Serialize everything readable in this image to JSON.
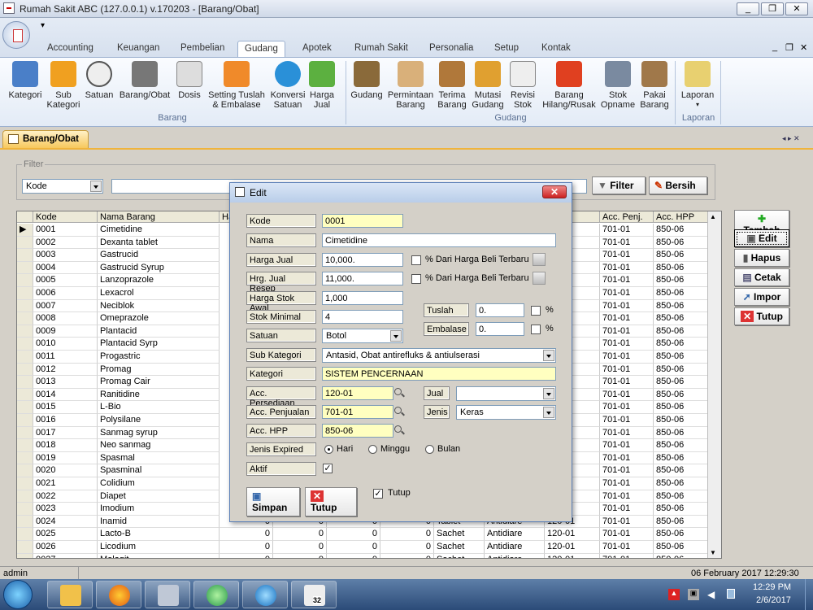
{
  "window": {
    "title": "Rumah Sakit ABC (127.0.0.1) v.170203 - [Barang/Obat]",
    "min": "_",
    "max": "❐",
    "close": "✕",
    "mdi_min": "_",
    "mdi_max": "❐",
    "mdi_close": "✕"
  },
  "ribbon": {
    "tabs": [
      "Accounting",
      "Keuangan",
      "Pembelian",
      "Gudang",
      "Apotek",
      "Rumah Sakit",
      "Personalia",
      "Setup",
      "Kontak"
    ],
    "active_tab": "Gudang",
    "barang_buttons": [
      "Kategori",
      "Sub Kategori",
      "Satuan",
      "Barang/Obat",
      "Dosis",
      "Setting Tuslah & Embalase",
      "Konversi Satuan",
      "Harga Jual"
    ],
    "gudang_buttons": [
      "Gudang",
      "Permintaan Barang",
      "Terima Barang",
      "Mutasi Gudang",
      "Revisi Stok",
      "Barang Hilang/Rusak",
      "Stok Opname",
      "Pakai Barang"
    ],
    "laporan_button": "Laporan",
    "groups": {
      "barang": "Barang",
      "gudang": "Gudang",
      "laporan": "Laporan"
    }
  },
  "doc_tab": "Barang/Obat",
  "filter": {
    "legend": "Filter",
    "field_value": "Kode",
    "filter_button": "Filter",
    "clear_button": "Bersih"
  },
  "grid": {
    "headers": [
      "Kode",
      "Nama Barang",
      "Ha",
      "Pers.",
      "Acc. Penj.",
      "Acc. HPP"
    ],
    "rows": [
      [
        "0001",
        "Cimetidine"
      ],
      [
        "0002",
        "Dexanta tablet"
      ],
      [
        "0003",
        "Gastrucid"
      ],
      [
        "0004",
        "Gastrucid Syrup"
      ],
      [
        "0005",
        "Lanzoprazole"
      ],
      [
        "0006",
        "Lexacrol"
      ],
      [
        "0007",
        "Neciblok"
      ],
      [
        "0008",
        "Omeprazole"
      ],
      [
        "0009",
        "Plantacid"
      ],
      [
        "0010",
        "Plantacid Syrp"
      ],
      [
        "0011",
        "Progastric"
      ],
      [
        "0012",
        "Promag"
      ],
      [
        "0013",
        "Promag Cair"
      ],
      [
        "0014",
        "Ranitidine"
      ],
      [
        "0015",
        "L-Bio"
      ],
      [
        "0016",
        "Polysilane"
      ],
      [
        "0017",
        "Sanmag syrup"
      ],
      [
        "0018",
        "Neo sanmag"
      ],
      [
        "0019",
        "Spasmal"
      ],
      [
        "0020",
        "Spasminal"
      ],
      [
        "0021",
        "Colidium"
      ],
      [
        "0022",
        "Diapet"
      ],
      [
        "0023",
        "Imodium"
      ],
      [
        "0024",
        "Inamid"
      ],
      [
        "0025",
        "Lacto-B"
      ],
      [
        "0026",
        "Licodium"
      ],
      [
        "0027",
        "Molagit"
      ]
    ],
    "acc_penj": "701-01",
    "acc_hpp": "850-06",
    "zero": "0",
    "row_25_extra": {
      "satuan": "Sachet",
      "kategori": "Antidiare",
      "pers": "120-01"
    },
    "row_26_extra": {
      "satuan": "Sachet",
      "kategori": "Antidiare",
      "pers": "120-01"
    },
    "row_24_extra": {
      "satuan": "Tablet",
      "kategori": "Antidiare",
      "pers": "120-01"
    }
  },
  "side_buttons": [
    "Tambah",
    "Edit",
    "Hapus",
    "Cetak",
    "Impor",
    "Tutup"
  ],
  "dialog": {
    "title": "Edit",
    "labels": {
      "kode": "Kode",
      "nama": "Nama",
      "harga_jual": "Harga Jual",
      "hrg_resep": "Hrg. Jual Resep",
      "harga_stok": "Harga Stok Awal",
      "stok_min": "Stok Minimal",
      "satuan": "Satuan",
      "sub_kategori": "Sub Kategori",
      "kategori": "Kategori",
      "acc_persediaan": "Acc. Persediaan",
      "acc_penjualan": "Acc. Penjualan",
      "acc_hpp": "Acc. HPP",
      "jenis_expired": "Jenis Expired",
      "aktif": "Aktif",
      "tuslah": "Tuslah",
      "embalase": "Embalase",
      "jual": "Jual",
      "jenis": "Jenis"
    },
    "values": {
      "kode": "0001",
      "nama": "Cimetidine",
      "harga_jual": "10,000.",
      "hrg_resep": "11,000.",
      "harga_stok": "1,000",
      "stok_min": "4",
      "satuan": "Botol",
      "sub_kategori": "Antasid, Obat antirefluks & antiulserasi",
      "kategori": "SISTEM PENCERNAAN",
      "acc_persediaan": "120-01",
      "acc_penjualan": "701-01",
      "acc_hpp": "850-06",
      "tuslah": "0.",
      "embalase": "0.",
      "jual": "",
      "jenis": "Keras"
    },
    "pct_text": "% Dari Harga Beli Terbaru",
    "pct": "%",
    "radios": [
      "Hari",
      "Minggu",
      "Bulan"
    ],
    "radio_selected": "Hari",
    "save": "Simpan",
    "close": "Tutup",
    "close_check": "Tutup",
    "check": "✓"
  },
  "status": {
    "user": "admin",
    "datetime": "06 February 2017  12:29:30"
  },
  "taskbar": {
    "time": "12:29 PM",
    "date": "2/6/2017",
    "badge": "32"
  }
}
